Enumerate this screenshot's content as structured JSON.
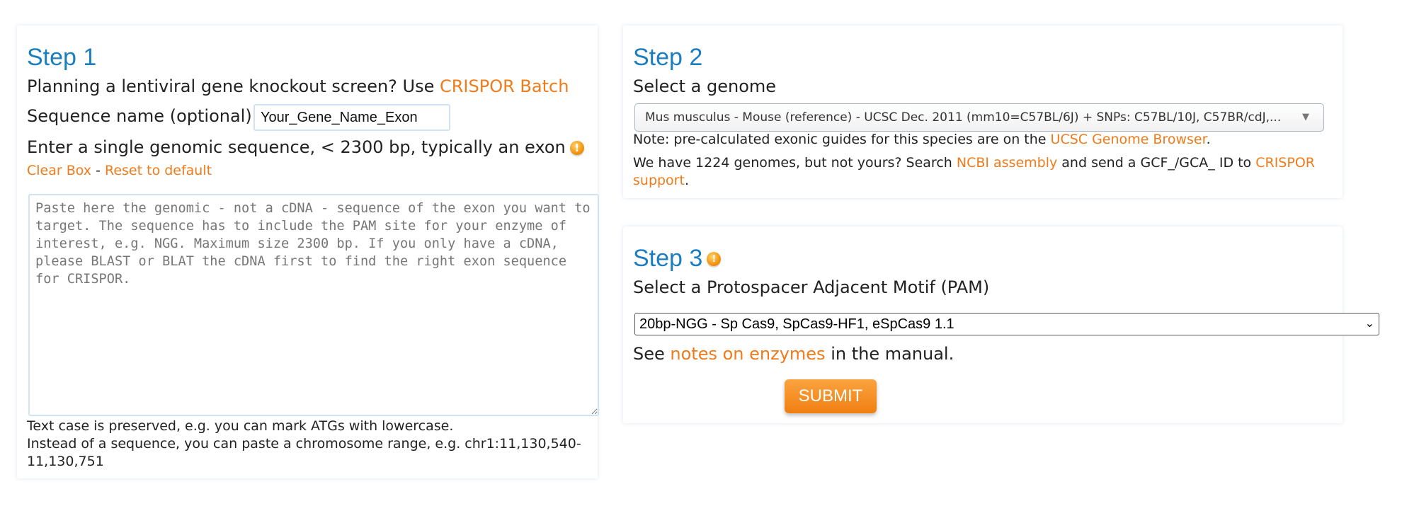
{
  "step1": {
    "title": "Step 1",
    "planning_text": "Planning a lentiviral gene knockout screen? Use ",
    "batch_link": "CRISPOR Batch",
    "seqname_label": "Sequence name (optional):",
    "seqname_value": "Your_Gene_Name_Exon",
    "enter_text": "Enter a single genomic sequence, < 2300 bp, typically an exon",
    "clear_box": "Clear Box",
    "separator": " - ",
    "reset_default": "Reset to default",
    "sequence_placeholder": "Paste here the genomic - not a cDNA - sequence of the exon you want to target. The sequence has to include the PAM site for your enzyme of interest, e.g. NGG. Maximum size 2300 bp. If you only have a cDNA, please BLAST or BLAT the cDNA first to find the right exon sequence for CRISPOR.",
    "note_case": "Text case is preserved, e.g. you can mark ATGs with lowercase.",
    "note_range_1": "Instead of a sequence, you can paste a chromosome range, e.g. chr1:11,130,540-",
    "note_range_2": "11,130,751"
  },
  "step2": {
    "title": "Step 2",
    "select_label": "Select a genome",
    "genome_value": "Mus musculus - Mouse (reference) - UCSC Dec. 2011 (mm10=C57BL/6J) + SNPs: C57BL/10J, C57BR/cdJ,...",
    "note_prefix": "Note: pre-calculated exonic guides for this species are on the ",
    "ucsc_link": "UCSC Genome Browser",
    "note_suffix": ".",
    "genomes_prefix": "We have 1224 genomes, but not yours? Search ",
    "ncbi_link": "NCBI assembly",
    "genomes_mid": " and send a GCF_/GCA_ ID to ",
    "support_link_1": "CRISPOR",
    "support_link_2": "support",
    "genomes_suffix": "."
  },
  "step3": {
    "title": "Step 3",
    "pam_label": "Select a Protospacer Adjacent Motif (PAM)",
    "pam_value": "20bp-NGG - Sp Cas9, SpCas9-HF1, eSpCas9 1.1",
    "see_prefix": "See ",
    "notes_link": "notes on enzymes",
    "see_suffix": " in the manual.",
    "submit_label": "SUBMIT"
  },
  "icons": {
    "help": "warning-help-icon",
    "dropdown": "chevron-down-icon"
  },
  "colors": {
    "step_title": "#1a7ebf",
    "link": "#ef7b1b",
    "submit_bg": "#f49226"
  }
}
